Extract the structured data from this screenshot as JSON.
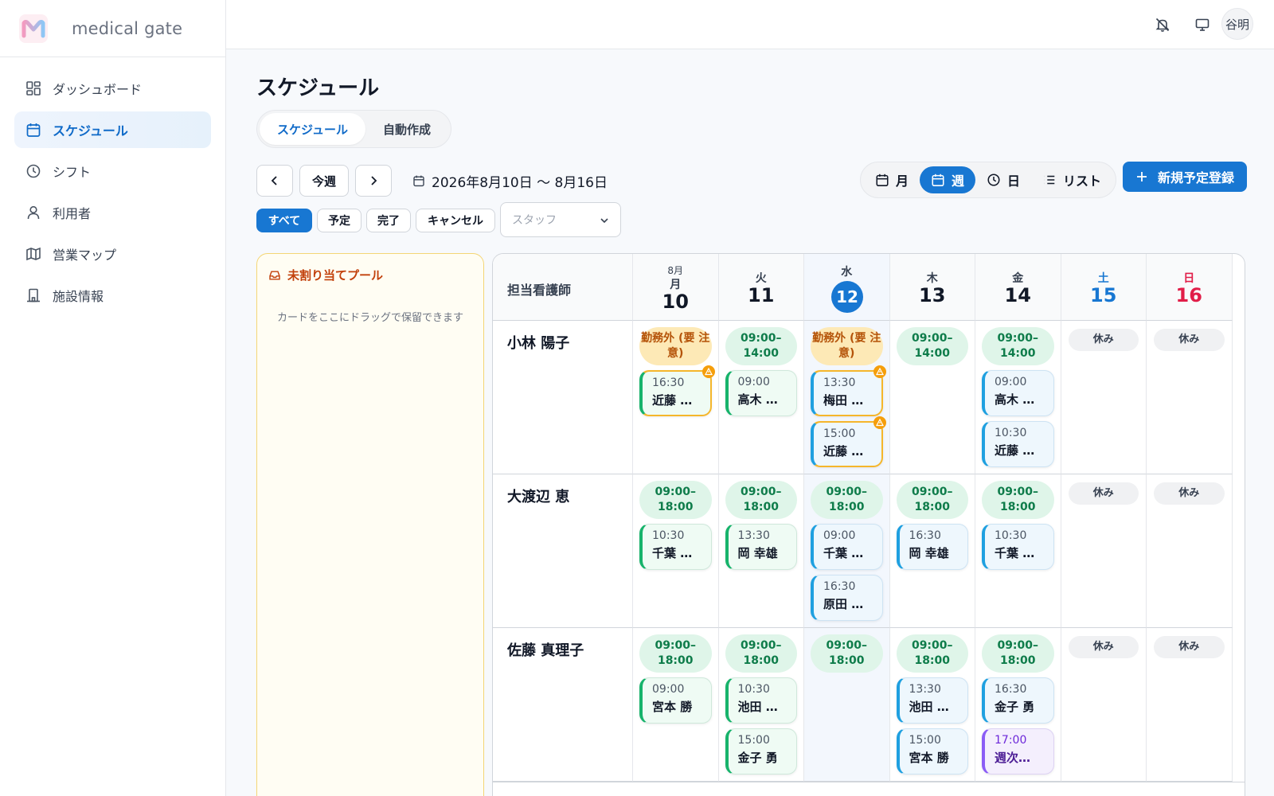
{
  "app": {
    "name": "medical gate",
    "logo_letter": "M"
  },
  "sidebar": {
    "items": [
      {
        "label": "ダッシュボード",
        "icon": "dashboard-icon",
        "active": false
      },
      {
        "label": "スケジュール",
        "icon": "calendar-icon",
        "active": true
      },
      {
        "label": "シフト",
        "icon": "clock-icon",
        "active": false
      },
      {
        "label": "利用者",
        "icon": "user-icon",
        "active": false
      },
      {
        "label": "営業マップ",
        "icon": "map-icon",
        "active": false
      },
      {
        "label": "施設情報",
        "icon": "building-icon",
        "active": false
      }
    ]
  },
  "topbar": {
    "user_name": "谷明"
  },
  "page": {
    "title": "スケジュール"
  },
  "tabs": [
    {
      "label": "スケジュール"
    },
    {
      "label": "自動作成"
    }
  ],
  "toolbar": {
    "this_week": "今週",
    "date_range": "2026年8月10日 〜 8月16日",
    "views": [
      {
        "label": "月"
      },
      {
        "label": "週"
      },
      {
        "label": "日"
      },
      {
        "label": "リスト"
      }
    ],
    "active_view": "週",
    "new_button": "新規予定登録"
  },
  "filters": {
    "chips": [
      {
        "label": "すべて"
      },
      {
        "label": "予定"
      },
      {
        "label": "完了"
      },
      {
        "label": "キャンセル"
      }
    ],
    "staff_placeholder": "スタッフ"
  },
  "pool": {
    "title": "未割り当てプール",
    "hint": "カードをここにドラッグで保留できます"
  },
  "grid": {
    "header_label": "担当看護師",
    "month_label": "8月",
    "days": [
      {
        "weekday": "月",
        "date": "10"
      },
      {
        "weekday": "火",
        "date": "11"
      },
      {
        "weekday": "水",
        "date": "12",
        "today": true
      },
      {
        "weekday": "木",
        "date": "13"
      },
      {
        "weekday": "金",
        "date": "14"
      },
      {
        "weekday": "土",
        "date": "15",
        "color": "#1877d2"
      },
      {
        "weekday": "日",
        "date": "16",
        "color": "#e11d48"
      }
    ],
    "off_label": "休み",
    "rows": [
      {
        "name": "小林 陽子",
        "days": [
          {
            "shift": "勤務外 (要 注意)",
            "shift_type": "warn",
            "appts": [
              {
                "time": "16:30",
                "name": "近藤 …",
                "color": "green",
                "warn": true
              }
            ]
          },
          {
            "shift": "09:00– 14:00",
            "shift_type": "ok",
            "appts": [
              {
                "time": "09:00",
                "name": "高木 …",
                "color": "green"
              }
            ]
          },
          {
            "shift": "勤務外 (要 注意)",
            "shift_type": "warn",
            "appts": [
              {
                "time": "13:30",
                "name": "梅田 …",
                "color": "blue",
                "warn": true
              },
              {
                "time": "15:00",
                "name": "近藤 …",
                "color": "blue",
                "warn": true
              }
            ]
          },
          {
            "shift": "09:00– 14:00",
            "shift_type": "ok",
            "appts": []
          },
          {
            "shift": "09:00– 14:00",
            "shift_type": "ok",
            "appts": [
              {
                "time": "09:00",
                "name": "高木 …",
                "color": "blue"
              },
              {
                "time": "10:30",
                "name": "近藤 …",
                "color": "blue"
              }
            ]
          },
          {
            "shift": "休み",
            "shift_type": "off",
            "appts": []
          },
          {
            "shift": "休み",
            "shift_type": "off",
            "appts": []
          }
        ]
      },
      {
        "name": "大渡辺 恵",
        "days": [
          {
            "shift": "09:00– 18:00",
            "shift_type": "ok",
            "appts": [
              {
                "time": "10:30",
                "name": "千葉 …",
                "color": "green"
              }
            ]
          },
          {
            "shift": "09:00– 18:00",
            "shift_type": "ok",
            "appts": [
              {
                "time": "13:30",
                "name": "岡 幸雄",
                "color": "green"
              }
            ]
          },
          {
            "shift": "09:00– 18:00",
            "shift_type": "ok",
            "appts": [
              {
                "time": "09:00",
                "name": "千葉 …",
                "color": "blue"
              },
              {
                "time": "16:30",
                "name": "原田 …",
                "color": "blue"
              }
            ]
          },
          {
            "shift": "09:00– 18:00",
            "shift_type": "ok",
            "appts": [
              {
                "time": "16:30",
                "name": "岡 幸雄",
                "color": "blue"
              }
            ]
          },
          {
            "shift": "09:00– 18:00",
            "shift_type": "ok",
            "appts": [
              {
                "time": "10:30",
                "name": "千葉 …",
                "color": "blue"
              }
            ]
          },
          {
            "shift": "休み",
            "shift_type": "off",
            "appts": []
          },
          {
            "shift": "休み",
            "shift_type": "off",
            "appts": []
          }
        ]
      },
      {
        "name": "佐藤 真理子",
        "days": [
          {
            "shift": "09:00– 18:00",
            "shift_type": "ok",
            "appts": [
              {
                "time": "09:00",
                "name": "宮本 勝",
                "color": "green"
              }
            ]
          },
          {
            "shift": "09:00– 18:00",
            "shift_type": "ok",
            "appts": [
              {
                "time": "10:30",
                "name": "池田 …",
                "color": "green"
              },
              {
                "time": "15:00",
                "name": "金子 勇",
                "color": "green"
              }
            ]
          },
          {
            "shift": "09:00– 18:00",
            "shift_type": "ok",
            "appts": []
          },
          {
            "shift": "09:00– 18:00",
            "shift_type": "ok",
            "appts": [
              {
                "time": "13:30",
                "name": "池田 …",
                "color": "blue"
              },
              {
                "time": "15:00",
                "name": "宮本 勝",
                "color": "blue"
              }
            ]
          },
          {
            "shift": "09:00– 18:00",
            "shift_type": "ok",
            "appts": [
              {
                "time": "16:30",
                "name": "金子 勇",
                "color": "blue"
              },
              {
                "time": "17:00",
                "name": "週次…",
                "color": "purple"
              }
            ]
          },
          {
            "shift": "休み",
            "shift_type": "off",
            "appts": []
          },
          {
            "shift": "休み",
            "shift_type": "off",
            "appts": []
          }
        ]
      }
    ]
  }
}
